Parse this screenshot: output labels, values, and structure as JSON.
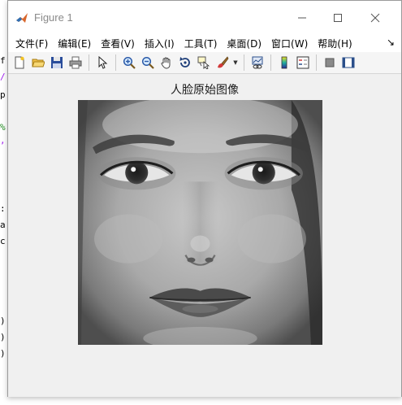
{
  "window": {
    "title": "Figure 1"
  },
  "menu": [
    "文件(F)",
    "编辑(E)",
    "查看(V)",
    "插入(I)",
    "工具(T)",
    "桌面(D)",
    "窗口(W)",
    "帮助(H)"
  ],
  "menu_overflow": "↘",
  "toolbar": {
    "items": [
      "new-figure-icon",
      "open-file-icon",
      "save-icon",
      "print-icon",
      "pointer-icon",
      "zoom-in-icon",
      "zoom-out-icon",
      "pan-hand-icon",
      "rotate-3d-icon",
      "data-cursor-icon",
      "brush-icon",
      "link-plot-icon",
      "colorbar-icon",
      "legend-icon",
      "hide-plot-tools-icon",
      "show-plot-tools-icon"
    ]
  },
  "axes": {
    "title": "人脸原始图像"
  },
  "image": {
    "description_icon": "grayscale-face-image"
  },
  "background_editor": {
    "lines": [
      "f",
      "/",
      "p",
      "%",
      ",",
      ":",
      "a",
      "c",
      ")",
      ")",
      ")"
    ]
  }
}
